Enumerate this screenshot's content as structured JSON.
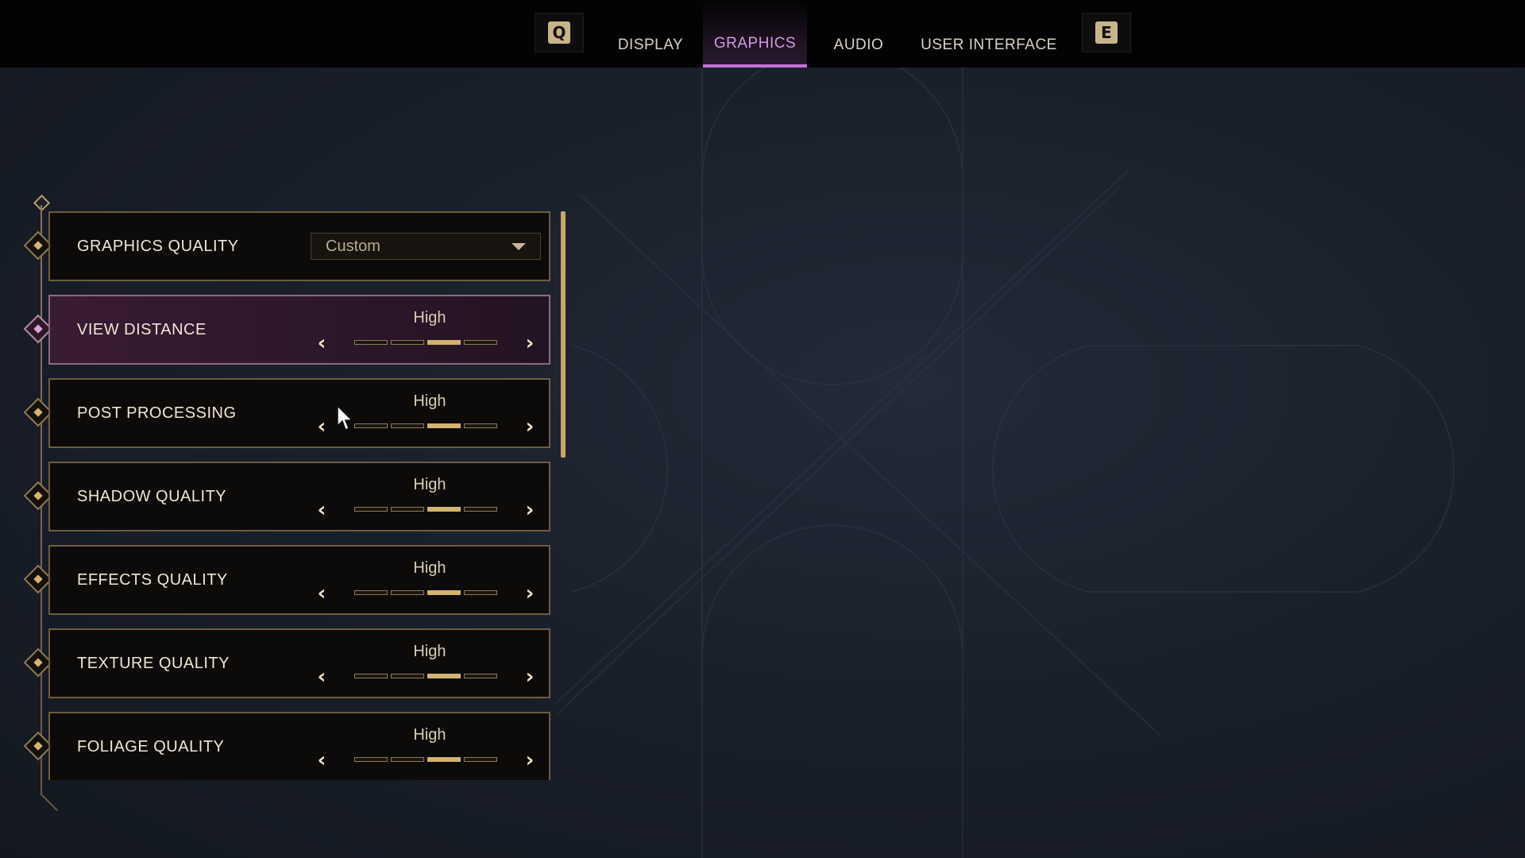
{
  "topbar": {
    "prev_key": "Q",
    "next_key": "E",
    "tabs": [
      {
        "label": "DISPLAY",
        "active": false
      },
      {
        "label": "GRAPHICS",
        "active": true
      },
      {
        "label": "AUDIO",
        "active": false
      },
      {
        "label": "USER INTERFACE",
        "active": false
      }
    ]
  },
  "settings": {
    "graphics_quality": {
      "label": "GRAPHICS QUALITY",
      "value": "Custom",
      "control": "dropdown"
    },
    "rows": [
      {
        "label": "VIEW DISTANCE",
        "value": "High",
        "level": 3,
        "levels": 4,
        "selected": true
      },
      {
        "label": "POST PROCESSING",
        "value": "High",
        "level": 3,
        "levels": 4,
        "selected": false
      },
      {
        "label": "SHADOW QUALITY",
        "value": "High",
        "level": 3,
        "levels": 4,
        "selected": false
      },
      {
        "label": "EFFECTS QUALITY",
        "value": "High",
        "level": 3,
        "levels": 4,
        "selected": false
      },
      {
        "label": "TEXTURE QUALITY",
        "value": "High",
        "level": 3,
        "levels": 4,
        "selected": false
      },
      {
        "label": "FOLIAGE QUALITY",
        "value": "High",
        "level": 3,
        "levels": 4,
        "selected": false
      }
    ]
  },
  "icons": {
    "prev_arrow": "chevron-left-icon",
    "next_arrow": "chevron-right-icon",
    "dropdown_caret": "caret-down-icon",
    "row_marker": "diamond-icon"
  },
  "colors": {
    "accent_active_tab": "#c472d6",
    "gold": "#d4b271",
    "row_border": "#6e5c3e"
  }
}
